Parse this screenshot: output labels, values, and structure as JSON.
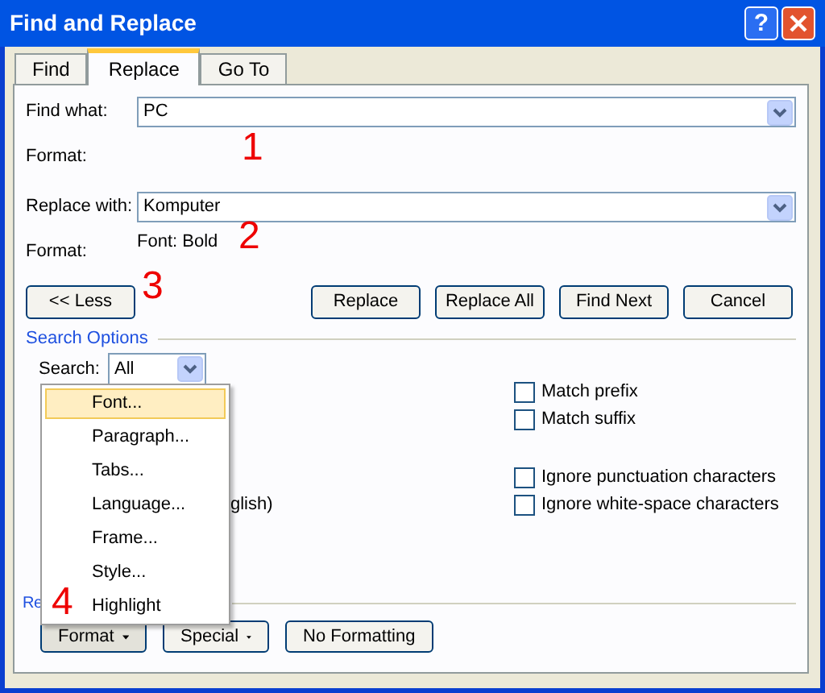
{
  "window": {
    "title": "Find and Replace",
    "help_glyph": "?"
  },
  "tabs": [
    {
      "label": "Find",
      "selected": false
    },
    {
      "label": "Replace",
      "selected": true
    },
    {
      "label": "Go To",
      "selected": false
    }
  ],
  "find": {
    "label": "Find what:",
    "value": "PC",
    "format_label": "Format:"
  },
  "replace": {
    "label": "Replace with:",
    "value": "Komputer",
    "format_label": "Format:",
    "format_value": "Font: Bold"
  },
  "less_button": "<< Less",
  "action_buttons": [
    "Replace",
    "Replace All",
    "Find Next",
    "Cancel"
  ],
  "search_options": {
    "title": "Search Options",
    "search_label": "Search:",
    "search_value": "All",
    "partly_hidden_text": "glish)",
    "checkboxes": [
      {
        "label": "Match prefix",
        "checked": false
      },
      {
        "label": "Match suffix",
        "checked": false
      },
      {
        "label": "Ignore punctuation characters",
        "checked": false
      },
      {
        "label": "Ignore white-space characters",
        "checked": false
      }
    ]
  },
  "replace_section_label": "Re",
  "bottom_buttons": [
    {
      "label": "Format",
      "pressed": true,
      "dropdown": true
    },
    {
      "label": "Special",
      "pressed": false,
      "dropdown": true
    },
    {
      "label": "No Formatting",
      "pressed": false,
      "dropdown": false
    }
  ],
  "format_menu": {
    "items": [
      {
        "label": "Font...",
        "selected": true
      },
      {
        "label": "Paragraph...",
        "selected": false
      },
      {
        "label": "Tabs...",
        "selected": false
      },
      {
        "label": "Language...",
        "selected": false
      },
      {
        "label": "Frame...",
        "selected": false
      },
      {
        "label": "Style...",
        "selected": false
      },
      {
        "label": "Highlight",
        "selected": false
      }
    ]
  },
  "annotations": [
    "1",
    "2",
    "3",
    "4"
  ]
}
